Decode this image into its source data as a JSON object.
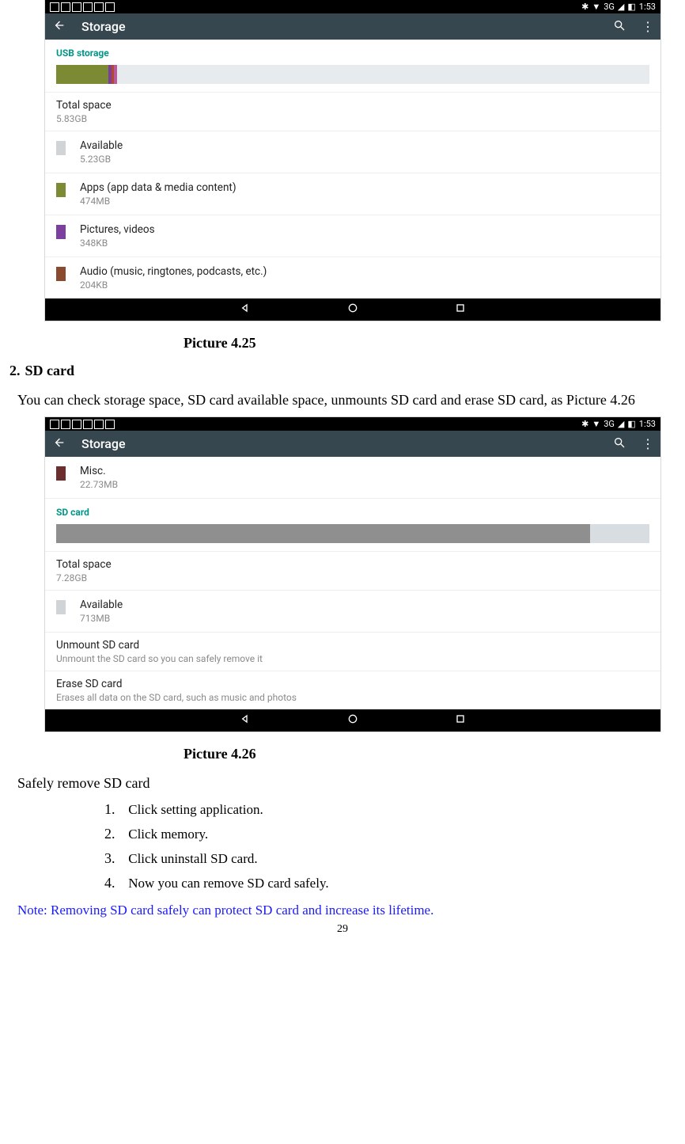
{
  "statusbar": {
    "network": "3G",
    "time": "1:53",
    "bt": "✱",
    "sig": "▲",
    "bat": "◧"
  },
  "appbar": {
    "title": "Storage"
  },
  "shot1": {
    "section": "USB storage",
    "segments": [
      {
        "color": "#7b8a33",
        "width": "8.8%"
      },
      {
        "color": "#7b3f9e",
        "width": "0.5%"
      },
      {
        "color": "#b24a2e",
        "width": "0.4%"
      },
      {
        "color": "#b85a9e",
        "width": "0.5%"
      }
    ],
    "barRemain": "89.8%",
    "total": {
      "label": "Total space",
      "value": "5.83GB"
    },
    "items": [
      {
        "name": "available",
        "label": "Available",
        "value": "5.23GB",
        "chip": "#d0d4d7"
      },
      {
        "name": "apps",
        "label": "Apps (app data & media content)",
        "value": "474MB",
        "chip": "#7b8a33"
      },
      {
        "name": "pictures",
        "label": "Pictures, videos",
        "value": "348KB",
        "chip": "#7b3f9e"
      },
      {
        "name": "audio",
        "label": "Audio (music, ringtones, podcasts, etc.)",
        "value": "204KB",
        "chip": "#8a4a2e"
      }
    ]
  },
  "caption1": "Picture 4.25",
  "h2": {
    "num": "2.",
    "text": "SD card"
  },
  "para": "You can check storage space, SD card available space, unmounts SD card and erase SD card, as Picture 4.26",
  "shot2": {
    "misc": {
      "label": "Misc.",
      "value": "22.73MB",
      "chip": "#6b2d2d"
    },
    "section": "SD card",
    "segWidth": "90%",
    "barRemain": "10%",
    "total": {
      "label": "Total space",
      "value": "7.28GB"
    },
    "available": {
      "label": "Available",
      "value": "713MB",
      "chip": "#d0d4d7"
    },
    "unmount": {
      "label": "Unmount SD card",
      "sub": "Unmount the SD card so you can safely remove it"
    },
    "erase": {
      "label": "Erase SD card",
      "sub": "Erases all data on the SD card, such as music and photos"
    }
  },
  "caption2": "Picture 4.26",
  "safeTitle": "Safely remove SD card",
  "steps": [
    "Click setting application.",
    "Click memory.",
    "Click uninstall SD card.",
    "Now you can remove SD card safely."
  ],
  "note": "Note: Removing SD card safely can protect SD card and increase its lifetime.",
  "pageno": "29"
}
